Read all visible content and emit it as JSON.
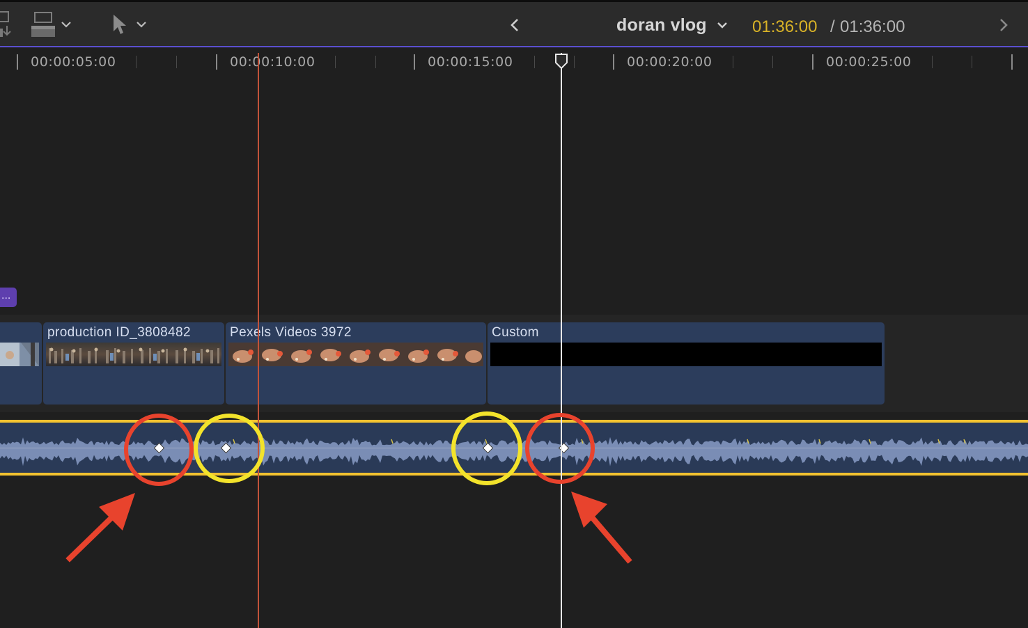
{
  "toolbar": {
    "project_name": "doran vlog",
    "timecode_current": "01:36:00",
    "timecode_separator": "/",
    "timecode_total": "01:36:00",
    "icons": [
      "append-clip-icon",
      "clip-appearance-icon",
      "chevron-down-icon",
      "select-tool-icon",
      "chevron-down-icon",
      "back-arrow-icon",
      "project-dropdown-chevron-icon",
      "forward-arrow-icon"
    ],
    "accent_color": "#5b4fd0",
    "timecode_color": "#d8b227"
  },
  "ruler": {
    "labels": [
      "00:00:05:00",
      "00:00:10:00",
      "00:00:15:00",
      "00:00:20:00",
      "00:00:25:00"
    ]
  },
  "timeline": {
    "connected_clip_label": "...",
    "clips": [
      {
        "title": "",
        "name": "clip-partial"
      },
      {
        "title": "production ID_3808482",
        "name": "clip-production"
      },
      {
        "title": "Pexels Videos 3972",
        "name": "clip-pexels"
      },
      {
        "title": "Custom",
        "name": "clip-custom"
      }
    ],
    "audio_lane_color": "#f2c230",
    "annotation_colors": {
      "red": "#e8432d",
      "yellow": "#f3e32b"
    }
  }
}
